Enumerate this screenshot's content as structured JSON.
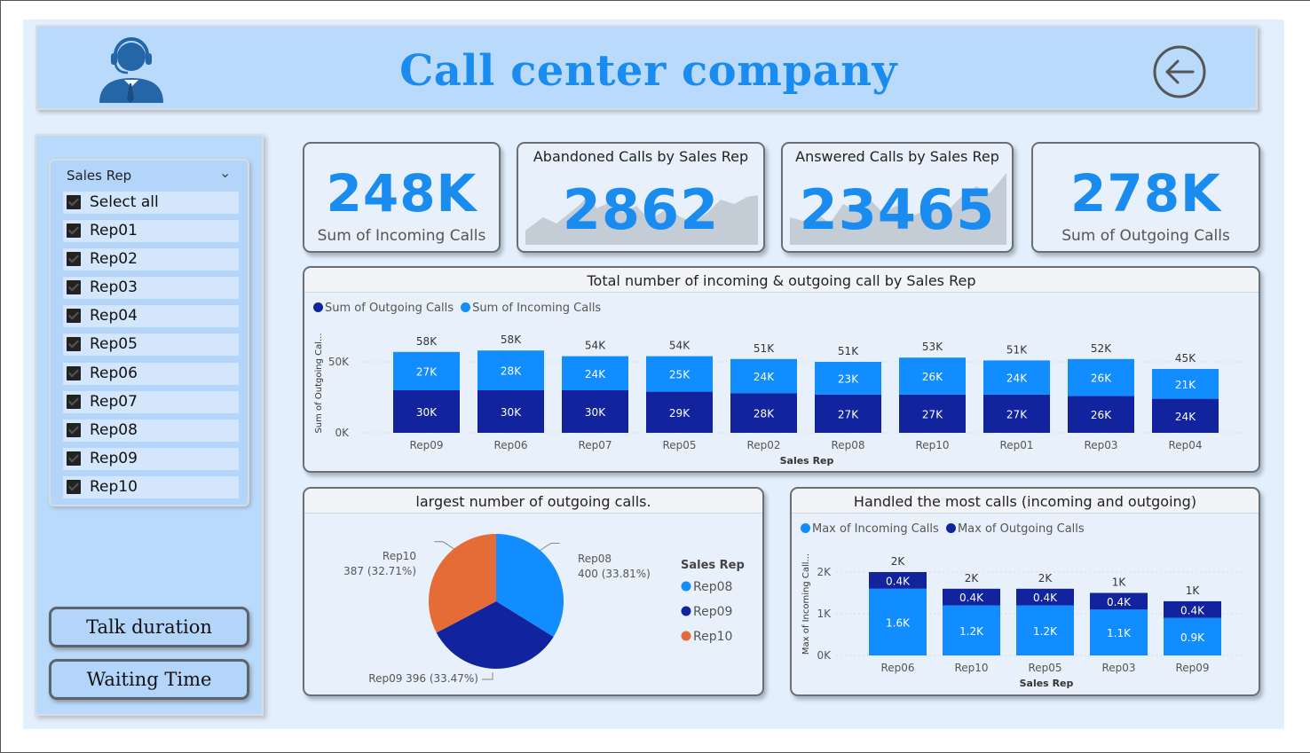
{
  "header": {
    "title": "Call center company"
  },
  "sidebar": {
    "slicer_title": "Sales Rep",
    "items": [
      "Select all",
      "Rep01",
      "Rep02",
      "Rep03",
      "Rep04",
      "Rep05",
      "Rep06",
      "Rep07",
      "Rep08",
      "Rep09",
      "Rep10"
    ],
    "buttons": {
      "talk_duration": "Talk duration",
      "waiting_time": "Waiting Time"
    }
  },
  "kpis": {
    "incoming": {
      "value": "248K",
      "label": "Sum of Incoming Calls"
    },
    "abandoned": {
      "title": "Abandoned Calls by Sales Rep",
      "value": "2862"
    },
    "answered": {
      "title": "Answered Calls by Sales Rep",
      "value": "23465"
    },
    "outgoing": {
      "value": "278K",
      "label": "Sum of Outgoing Calls"
    }
  },
  "colors": {
    "accent": "#1a8cf0",
    "dark_blue": "#12239e",
    "orange": "#e66c37",
    "bright_blue": "#118dff"
  },
  "chart_data": [
    {
      "type": "bar",
      "title": "Total number of incoming & outgoing call by Sales Rep",
      "xlabel": "Sales Rep",
      "ylabel": "Sum of Outgoing Cal...",
      "yticks": [
        "0K",
        "50K"
      ],
      "legend_position": "top-left",
      "categories": [
        "Rep09",
        "Rep06",
        "Rep07",
        "Rep05",
        "Rep02",
        "Rep08",
        "Rep10",
        "Rep01",
        "Rep03",
        "Rep04"
      ],
      "series": [
        {
          "name": "Sum of Outgoing Calls",
          "values": [
            30,
            30,
            30,
            29,
            28,
            27,
            27,
            27,
            26,
            24
          ],
          "labels": [
            "30K",
            "30K",
            "30K",
            "29K",
            "28K",
            "27K",
            "27K",
            "27K",
            "26K",
            "24K"
          ],
          "color": "#12239e"
        },
        {
          "name": "Sum of Incoming Calls",
          "values": [
            27,
            28,
            24,
            25,
            24,
            23,
            26,
            24,
            26,
            21
          ],
          "labels": [
            "27K",
            "28K",
            "24K",
            "25K",
            "24K",
            "23K",
            "26K",
            "24K",
            "26K",
            "21K"
          ],
          "color": "#118dff"
        }
      ],
      "totals": [
        "58K",
        "58K",
        "54K",
        "54K",
        "51K",
        "51K",
        "53K",
        "51K",
        "52K",
        "45K"
      ],
      "stacked": true
    },
    {
      "type": "pie",
      "title": "largest number of outgoing calls.",
      "legend_title": "Sales Rep",
      "legend_position": "right",
      "slices": [
        {
          "name": "Rep08",
          "value": 400,
          "label": "400 (33.81%)",
          "color": "#118dff"
        },
        {
          "name": "Rep09",
          "value": 396,
          "label": "Rep09 396 (33.47%)",
          "color": "#12239e"
        },
        {
          "name": "Rep10",
          "value": 387,
          "label": "387 (32.71%)",
          "color": "#e66c37"
        }
      ]
    },
    {
      "type": "bar",
      "title": "Handled the most calls (incoming and outgoing)",
      "xlabel": "Sales Rep",
      "ylabel": "Max of Incoming Call...",
      "yticks": [
        "0K",
        "1K",
        "2K"
      ],
      "legend_position": "top-left",
      "categories": [
        "Rep06",
        "Rep10",
        "Rep05",
        "Rep03",
        "Rep09"
      ],
      "series": [
        {
          "name": "Max of Incoming Calls",
          "values": [
            1.6,
            1.2,
            1.2,
            1.1,
            0.9
          ],
          "labels": [
            "1.6K",
            "1.2K",
            "1.2K",
            "1.1K",
            "0.9K"
          ],
          "color": "#118dff"
        },
        {
          "name": "Max of Outgoing Calls",
          "values": [
            0.4,
            0.4,
            0.4,
            0.4,
            0.4
          ],
          "labels": [
            "0.4K",
            "0.4K",
            "0.4K",
            "0.4K",
            "0.4K"
          ],
          "color": "#12239e"
        }
      ],
      "totals": [
        "2K",
        "2K",
        "2K",
        "1K",
        "1K"
      ],
      "stacked": true
    }
  ]
}
